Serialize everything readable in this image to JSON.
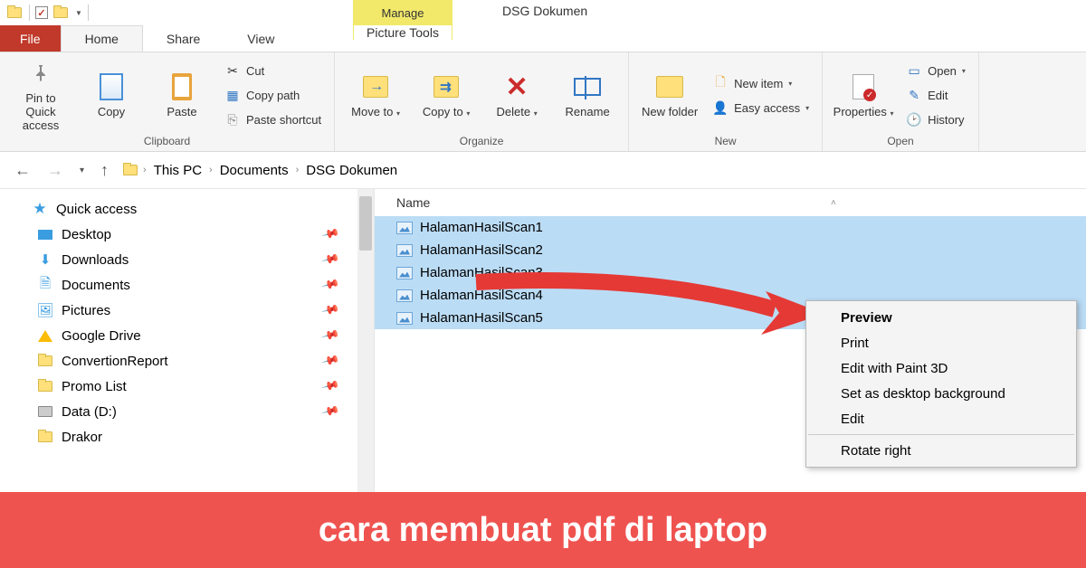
{
  "titlebar": {
    "contextual_tab": "Manage",
    "window_title": "DSG Dokumen"
  },
  "tabs": {
    "file": "File",
    "home": "Home",
    "share": "Share",
    "view": "View",
    "picture_tools": "Picture Tools"
  },
  "ribbon": {
    "clipboard": {
      "pin": "Pin to Quick access",
      "copy": "Copy",
      "paste": "Paste",
      "cut": "Cut",
      "copy_path": "Copy path",
      "paste_shortcut": "Paste shortcut",
      "label": "Clipboard"
    },
    "organize": {
      "move_to": "Move to",
      "copy_to": "Copy to",
      "delete": "Delete",
      "rename": "Rename",
      "label": "Organize"
    },
    "new": {
      "new_folder": "New folder",
      "new_item": "New item",
      "easy_access": "Easy access",
      "label": "New"
    },
    "open": {
      "properties": "Properties",
      "open": "Open",
      "edit": "Edit",
      "history": "History",
      "label": "Open"
    }
  },
  "breadcrumb": {
    "this_pc": "This PC",
    "documents": "Documents",
    "dsg": "DSG Dokumen"
  },
  "sidebar": {
    "quick_access": "Quick access",
    "desktop": "Desktop",
    "downloads": "Downloads",
    "documents": "Documents",
    "pictures": "Pictures",
    "gdrive": "Google Drive",
    "convertion": "ConvertionReport",
    "promo": "Promo List",
    "data_d": "Data (D:)",
    "drakor": "Drakor"
  },
  "filelist": {
    "column_name": "Name",
    "files": [
      "HalamanHasilScan1",
      "HalamanHasilScan2",
      "HalamanHasilScan3",
      "HalamanHasilScan4",
      "HalamanHasilScan5"
    ]
  },
  "contextmenu": {
    "preview": "Preview",
    "print": "Print",
    "edit_paint3d": "Edit with Paint 3D",
    "set_bg": "Set as desktop background",
    "edit": "Edit",
    "rotate_right": "Rotate right"
  },
  "caption": "cara membuat pdf di laptop"
}
